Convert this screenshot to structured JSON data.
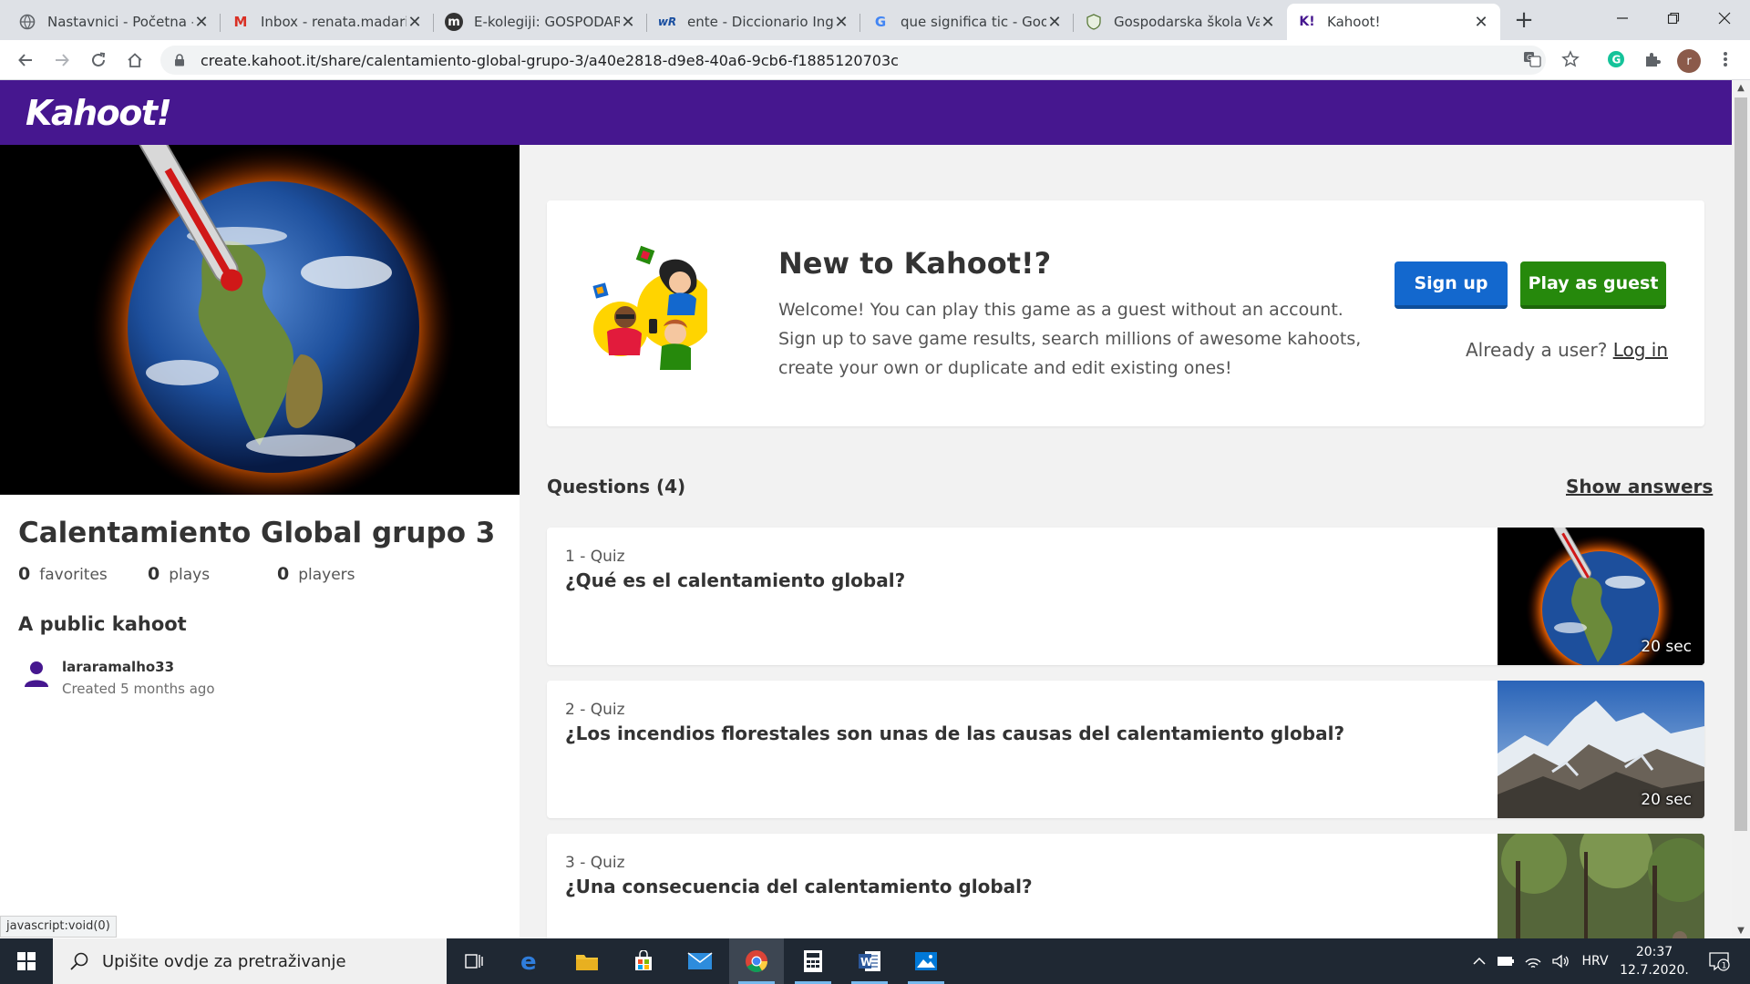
{
  "browser": {
    "tabs": [
      {
        "label": "Nastavnici - Početna - ",
        "favicon": "N"
      },
      {
        "label": "Inbox - renata.madaric",
        "favicon": "M"
      },
      {
        "label": "E-kolegiji: GOSPODARS",
        "favicon": "m"
      },
      {
        "label": "ente - Diccionario Ingle",
        "favicon": "wR"
      },
      {
        "label": "que significa tic - Goog",
        "favicon": "G"
      },
      {
        "label": "Gospodarska škola Var",
        "favicon": "shield"
      },
      {
        "label": "Kahoot!",
        "favicon": "K!"
      }
    ],
    "tab_close": "✕",
    "new_tab": "+",
    "url": "create.kahoot.it/share/calentamiento-global-grupo-3/a40e2818-d9e8-40a6-9cb6-f1885120703c",
    "profile_initial": "r",
    "status_text": "javascript:void(0)"
  },
  "header": {
    "logo": "Kahoot!"
  },
  "kahoot": {
    "title": "Calentamiento Global grupo 3",
    "stats": [
      {
        "value": "0",
        "label": "favorites"
      },
      {
        "value": "0",
        "label": "plays"
      },
      {
        "value": "0",
        "label": "players"
      }
    ],
    "visibility": "A public kahoot",
    "creator": "lararamalho33",
    "created": "Created 5 months ago"
  },
  "promo": {
    "heading": "New to Kahoot!?",
    "text": "Welcome! You can play this game as a guest without an account. Sign up to save game results, search millions of awesome kahoots, create your own or duplicate and edit existing ones!",
    "signup": "Sign up",
    "guest": "Play as guest",
    "already": "Already a user?",
    "login": "Log in"
  },
  "questions": {
    "header": "Questions (4)",
    "show_answers": "Show answers",
    "items": [
      {
        "type": "1 - Quiz",
        "text": "¿Qué es el calentamiento global?",
        "time": "20 sec",
        "image": "earth-thermometer"
      },
      {
        "type": "2 - Quiz",
        "text": "¿Los incendios florestales son unas de las causas del calentamiento global?",
        "time": "20 sec",
        "image": "mountains"
      },
      {
        "type": "3 - Quiz",
        "text": "¿Una consecuencia del calentamiento global?",
        "time": "",
        "image": "forest"
      }
    ]
  },
  "taskbar": {
    "search_placeholder": "Upišite ovdje za pretraživanje",
    "language": "HRV",
    "time": "20:37",
    "date": "12.7.2020.",
    "notifications": "1"
  },
  "colors": {
    "kahoot_purple": "#46178f",
    "signup_blue": "#1368ce",
    "guest_green": "#26890c"
  }
}
